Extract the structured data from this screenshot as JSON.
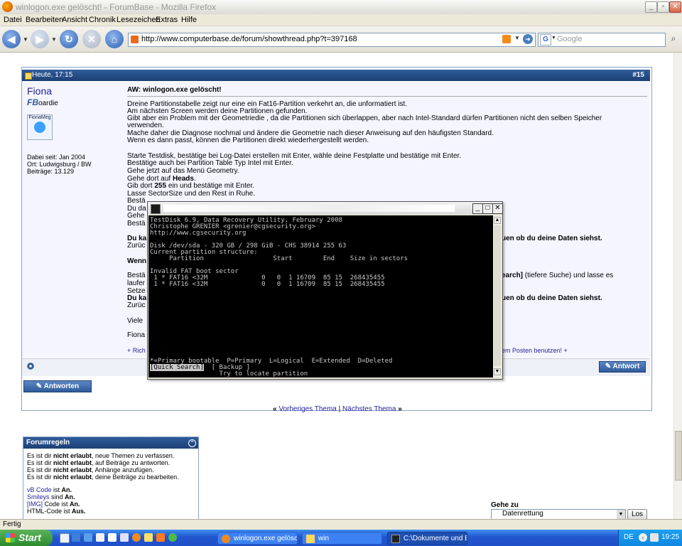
{
  "window": {
    "title": "winlogon.exe gelöscht! - ForumBase - Mozilla Firefox"
  },
  "menu": [
    "Datei",
    "Bearbeiten",
    "Ansicht",
    "Chronik",
    "Lesezeichen",
    "Extras",
    "Hilfe"
  ],
  "navbar": {
    "url": "http://www.computerbase.de/forum/showthread.php?t=397168",
    "search_placeholder": "Google",
    "search_engine": "G"
  },
  "post": {
    "date": "Heute, 17:15",
    "number": "#15",
    "title": "AW: winlogon.exe gelöscht!",
    "author": {
      "name": "Fiona",
      "title_prefix": "FB",
      "title_suffix": "oardie",
      "avatar_text": "FionaMeg",
      "joined": "Dabei seit: Jan 2004",
      "location": "Ort: Ludwigsburg / BW",
      "posts": "Beiträge: 13.129"
    },
    "lines": [
      "Dreine Partitionstabelle zeigt nur eine ein Fat16-Partition verkehrt an, die unformatiert ist.",
      "Am nächsten Screen werden deine Partitionen gefunden.",
      "Gibt aber ein Problem mit der Geometriedie , da die Partitionen sich überlappen, aber nach Intel-Standard dürfen Partitionen nicht den selben Speicher",
      "verwenden.",
      "Mache daher die Diagnose nochmal und ändere die Geometrie nach dieser Anweisung auf den häufigsten Standard.",
      "Wenn es dann passt, können die Partitionen direkt wiederhergestellt werden.",
      "",
      "Starte Testdisk, bestätige bei Log-Datei erstellen mit Enter, wähle deine Festplatte und bestätige mit Enter.",
      "Bestätige auch bei Partition Table Typ Intel mit Enter.",
      "Gehe jetzt auf das Menü Geometry.",
      "Gehe dort auf Heads.",
      "Gib dort 255 ein und bestätige mit Enter.",
      "Lasse SectorSize und den Rest in Ruhe.",
      "Bestä",
      "Du da",
      "Gehe",
      "Bestä",
      "",
      "Du ka",
      "Zurüc",
      "",
      "Wenn",
      "",
      "Bestä",
      "laufer",
      "Setze",
      "Du ka",
      "Zurüc",
      "",
      "Viele",
      "",
      "Fiona"
    ],
    "right_fragments": {
      "r1": "uen ob du deine Daten siehst.",
      "r2a": "earch]",
      "r2b": " (tiefere Suche) und lasse es",
      "r3": "uen ob du deine Daten siehst."
    },
    "footer_left": "+ Rich",
    "footer_right": "em Posten benutzen! +",
    "reply_button": "Antwort",
    "bold_words": {
      "heads": "Heads",
      "val": "255"
    }
  },
  "reply_main_button": "Antworten",
  "thread_nav": {
    "prev": "Vorheriges Thema",
    "sep": "|",
    "next": "Nächstes Thema"
  },
  "forumregeln": {
    "title": "Forumregeln",
    "rules": [
      {
        "pre": "Es ist dir ",
        "bold": "nicht erlaubt",
        "post": ", neue Themen zu verfassen."
      },
      {
        "pre": "Es ist dir ",
        "bold": "nicht erlaubt",
        "post": ", auf Beiträge zu antworten."
      },
      {
        "pre": "Es ist dir ",
        "bold": "nicht erlaubt",
        "post": ", Anhänge anzufügen."
      },
      {
        "pre": "Es ist dir ",
        "bold": "nicht erlaubt",
        "post": ", deine Beiträge zu bearbeiten."
      }
    ],
    "codes": [
      {
        "link": "vB Code",
        "mid": " ist ",
        "val": "An."
      },
      {
        "link": "Smileys",
        "mid": " sind ",
        "val": "An."
      },
      {
        "link": "[IMG]",
        "mid": " Code ist ",
        "val": "An."
      },
      {
        "link": "HTML-Code",
        "mid": " ist ",
        "val": "Aus."
      }
    ]
  },
  "gehe_zu": {
    "label": "Gehe zu",
    "selected": "Datenrettung",
    "button": "Los"
  },
  "terminal": {
    "lines": [
      "TestDisk 6.9, Data Recovery Utility, February 2008",
      "Christophe GRENIER <grenier@cgsecurity.org>",
      "http://www.cgsecurity.org",
      "",
      "Disk /dev/sda - 320 GB / 298 GiB - CHS 38914 255 63",
      "Current partition structure:",
      "     Partition                  Start        End    Size in sectors",
      "",
      "Invalid FAT boot sector",
      " 1 * FAT16 <32M              0   0  1 16709  85 15  268435455",
      " 1 * FAT16 <32M              0   0  1 16709  85 15  268435455",
      "",
      "",
      "",
      "",
      "",
      "",
      "",
      "",
      "",
      "",
      "",
      "*=Primary bootable  P=Primary  L=Logical  E=Extended  D=Deleted"
    ],
    "menu_selected": "[Quick Search]",
    "menu_other": "  [ Backup ]",
    "hint": "                  Try to locate partition"
  },
  "status": "Fertig",
  "taskbar": {
    "start": "Start",
    "tasks": [
      "winlogon.exe gelösch...",
      "win",
      "C:\\Dokumente und Ei..."
    ],
    "lang": "DE",
    "clock": "19:25"
  }
}
